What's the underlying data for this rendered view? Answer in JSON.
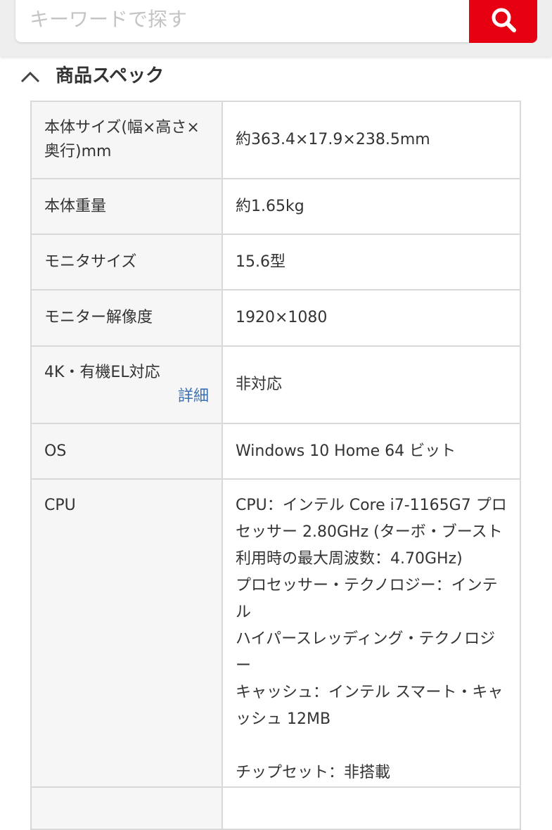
{
  "search": {
    "placeholder": "キーワードで探す",
    "button_icon": "search-icon"
  },
  "section": {
    "title": "商品スペック",
    "toggle_icon": "chevron-up-icon"
  },
  "specs": [
    {
      "label": "本体サイズ(幅×高さ×奥行)mm",
      "value": "約363.4×17.9×238.5mm"
    },
    {
      "label": "本体重量",
      "value": "約1.65kg"
    },
    {
      "label": "モニタサイズ",
      "value": "15.6型"
    },
    {
      "label": "モニター解像度",
      "value": "1920×1080"
    },
    {
      "label": "4K・有機EL対応",
      "link": "詳細",
      "value": "非対応"
    },
    {
      "label": "OS",
      "value": "Windows 10 Home 64 ビット"
    },
    {
      "label": "CPU",
      "value_lines": [
        "CPU：インテル Core i7-1165G7 プロ",
        "セッサー 2.80GHz (ターボ・ブースト",
        "利用時の最大周波数：4.70GHz)",
        "プロセッサー・テクノロジー：インテル",
        "ハイパースレッディング・テクノロジー",
        "キャッシュ：インテル スマート・キャ",
        "ッシュ 12MB",
        "",
        "チップセット：非搭載"
      ]
    }
  ],
  "colors": {
    "accent": "#e60012",
    "link": "#3b6fb3",
    "border": "#d9d9d9",
    "label_bg": "#f6f6f6"
  }
}
